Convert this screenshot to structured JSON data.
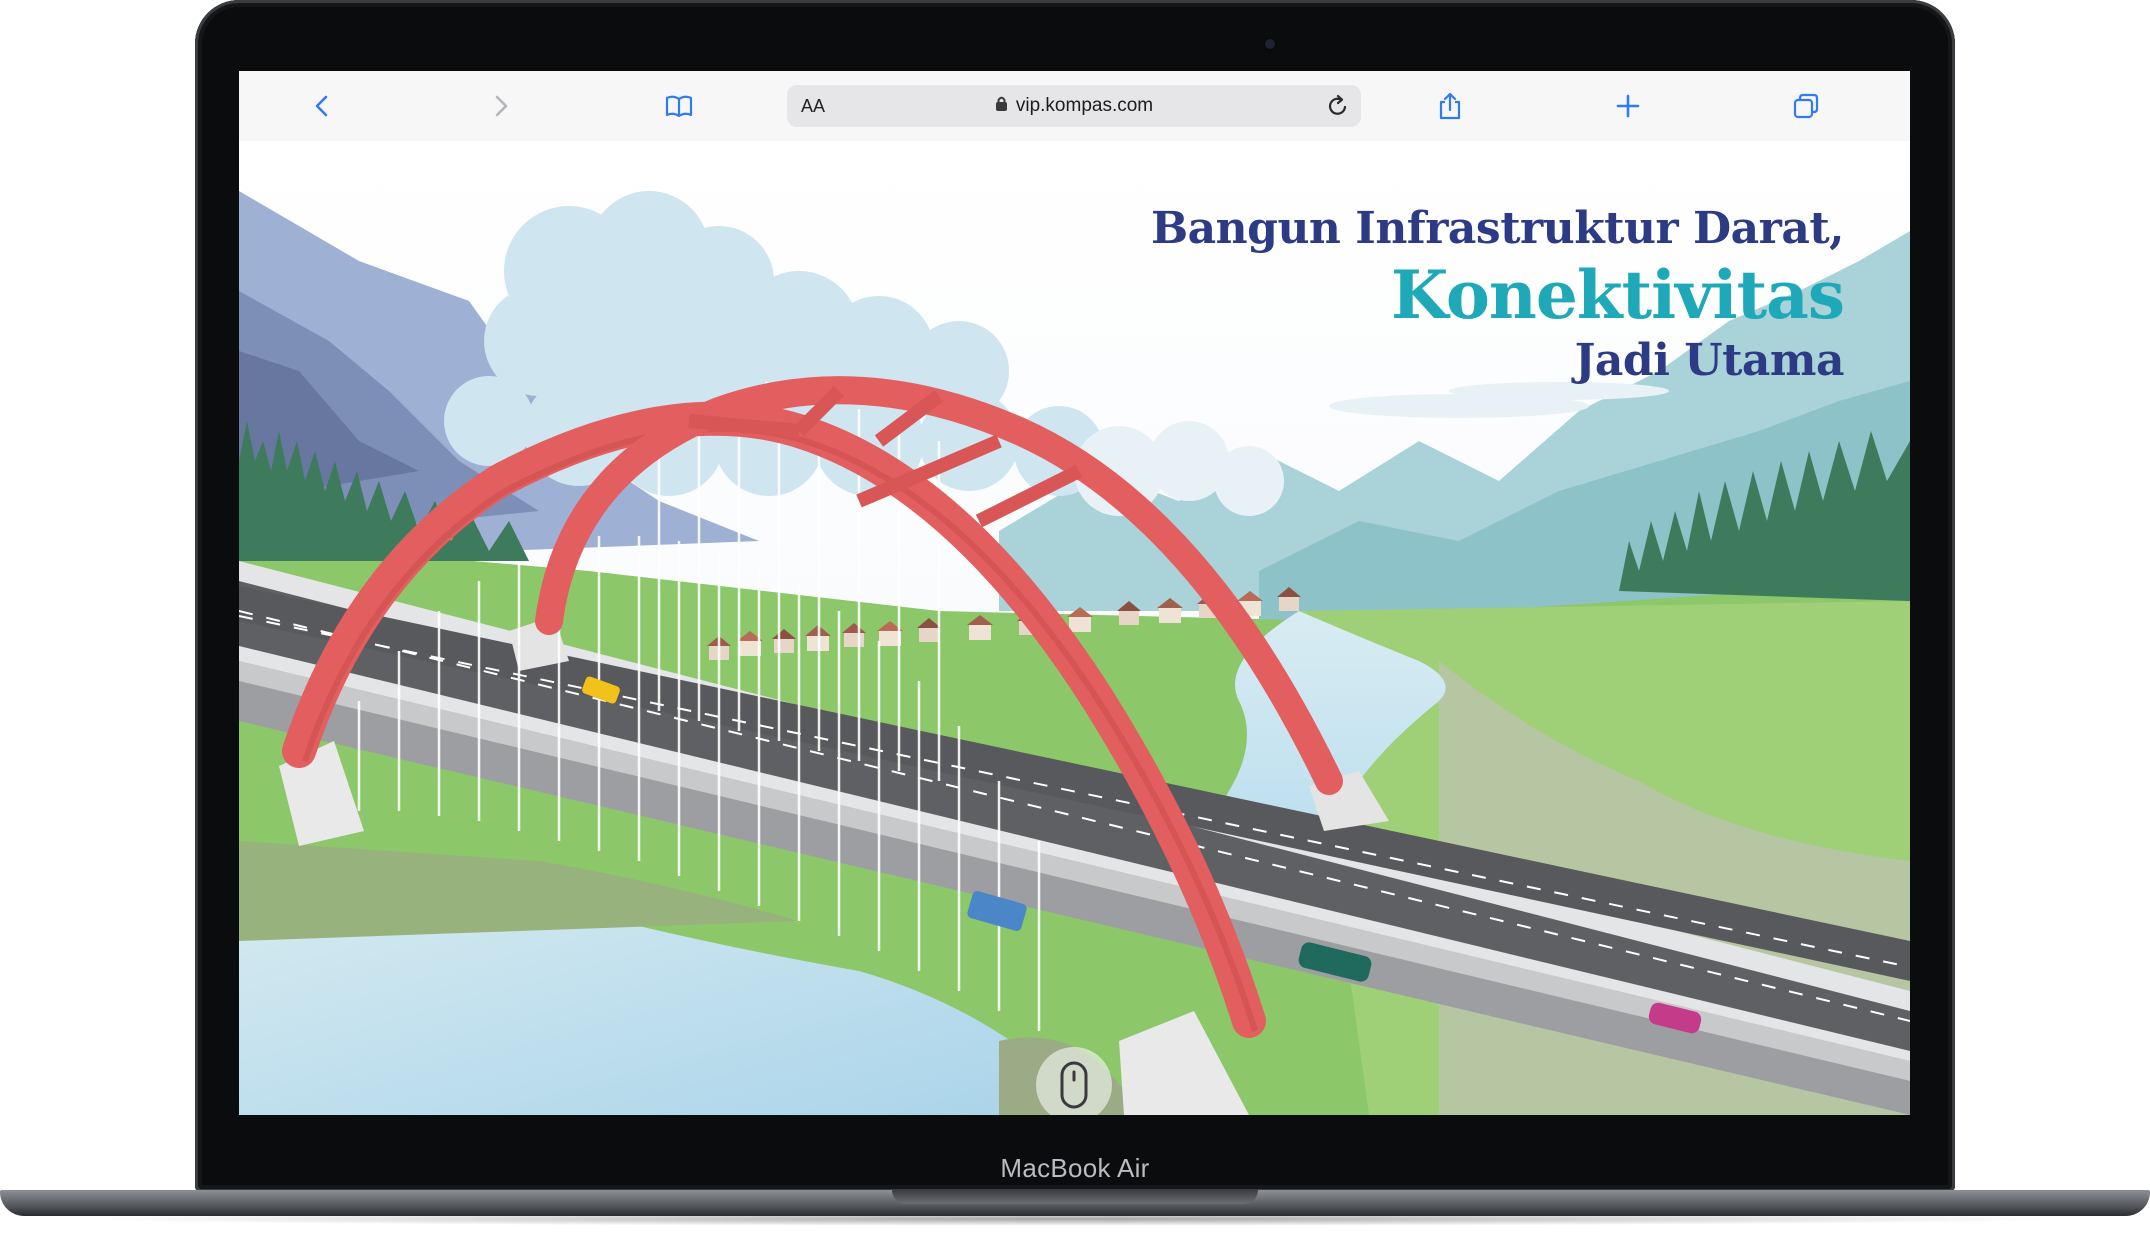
{
  "browser": {
    "address": {
      "text_size_label": "AA",
      "url": "vip.kompas.com"
    },
    "toolbar_icons": [
      "back-icon",
      "forward-icon",
      "bookmarks-icon",
      "lock-icon",
      "reload-icon",
      "share-icon",
      "new-tab-icon",
      "tabs-icon"
    ]
  },
  "page": {
    "headline": {
      "line1": "Bangun Infrastruktur Darat,",
      "line2": "Konektivitas",
      "line3": "Jadi Utama"
    },
    "colors": {
      "headline_dark": "#2d3a84",
      "headline_accent": "#1fa9b8",
      "bridge_arch": "#e35f5f",
      "road": "#5f6063"
    },
    "scroll_hint_icon": "mouse-icon"
  },
  "device": {
    "label": "MacBook Air"
  }
}
